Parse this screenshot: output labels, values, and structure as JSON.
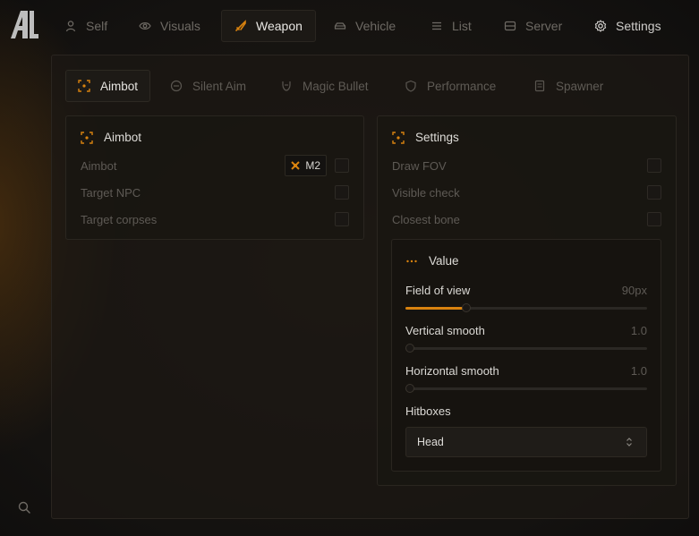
{
  "nav": {
    "tabs": [
      {
        "label": "Self",
        "icon": "user-icon"
      },
      {
        "label": "Visuals",
        "icon": "eye-icon"
      },
      {
        "label": "Weapon",
        "icon": "weapon-icon",
        "active": true
      },
      {
        "label": "Vehicle",
        "icon": "car-icon"
      },
      {
        "label": "List",
        "icon": "list-icon"
      },
      {
        "label": "Server",
        "icon": "server-icon"
      },
      {
        "label": "Settings",
        "icon": "gear-icon"
      }
    ]
  },
  "subtabs": [
    {
      "label": "Aimbot",
      "icon": "crosshair-icon",
      "active": true
    },
    {
      "label": "Silent Aim",
      "icon": "target-icon"
    },
    {
      "label": "Magic Bullet",
      "icon": "bullet-icon"
    },
    {
      "label": "Performance",
      "icon": "shield-icon"
    },
    {
      "label": "Spawner",
      "icon": "document-icon"
    }
  ],
  "aimbot_card": {
    "title": "Aimbot",
    "rows": [
      {
        "label": "Aimbot",
        "checked": false,
        "keybind": "M2"
      },
      {
        "label": "Target NPC",
        "checked": false
      },
      {
        "label": "Target corpses",
        "checked": false
      }
    ]
  },
  "settings_card": {
    "title": "Settings",
    "rows": [
      {
        "label": "Draw FOV",
        "checked": false
      },
      {
        "label": "Visible check",
        "checked": false
      },
      {
        "label": "Closest bone",
        "checked": false
      }
    ],
    "value": {
      "title": "Value",
      "sliders": [
        {
          "label": "Field of view",
          "value": "90px",
          "fraction": 0.25
        },
        {
          "label": "Vertical smooth",
          "value": "1.0",
          "fraction": 0.0
        },
        {
          "label": "Horizontal smooth",
          "value": "1.0",
          "fraction": 0.0
        }
      ],
      "hitboxes": {
        "label": "Hitboxes",
        "selected": "Head"
      }
    }
  },
  "colors": {
    "accent": "#d8820f",
    "background": "#141210"
  }
}
